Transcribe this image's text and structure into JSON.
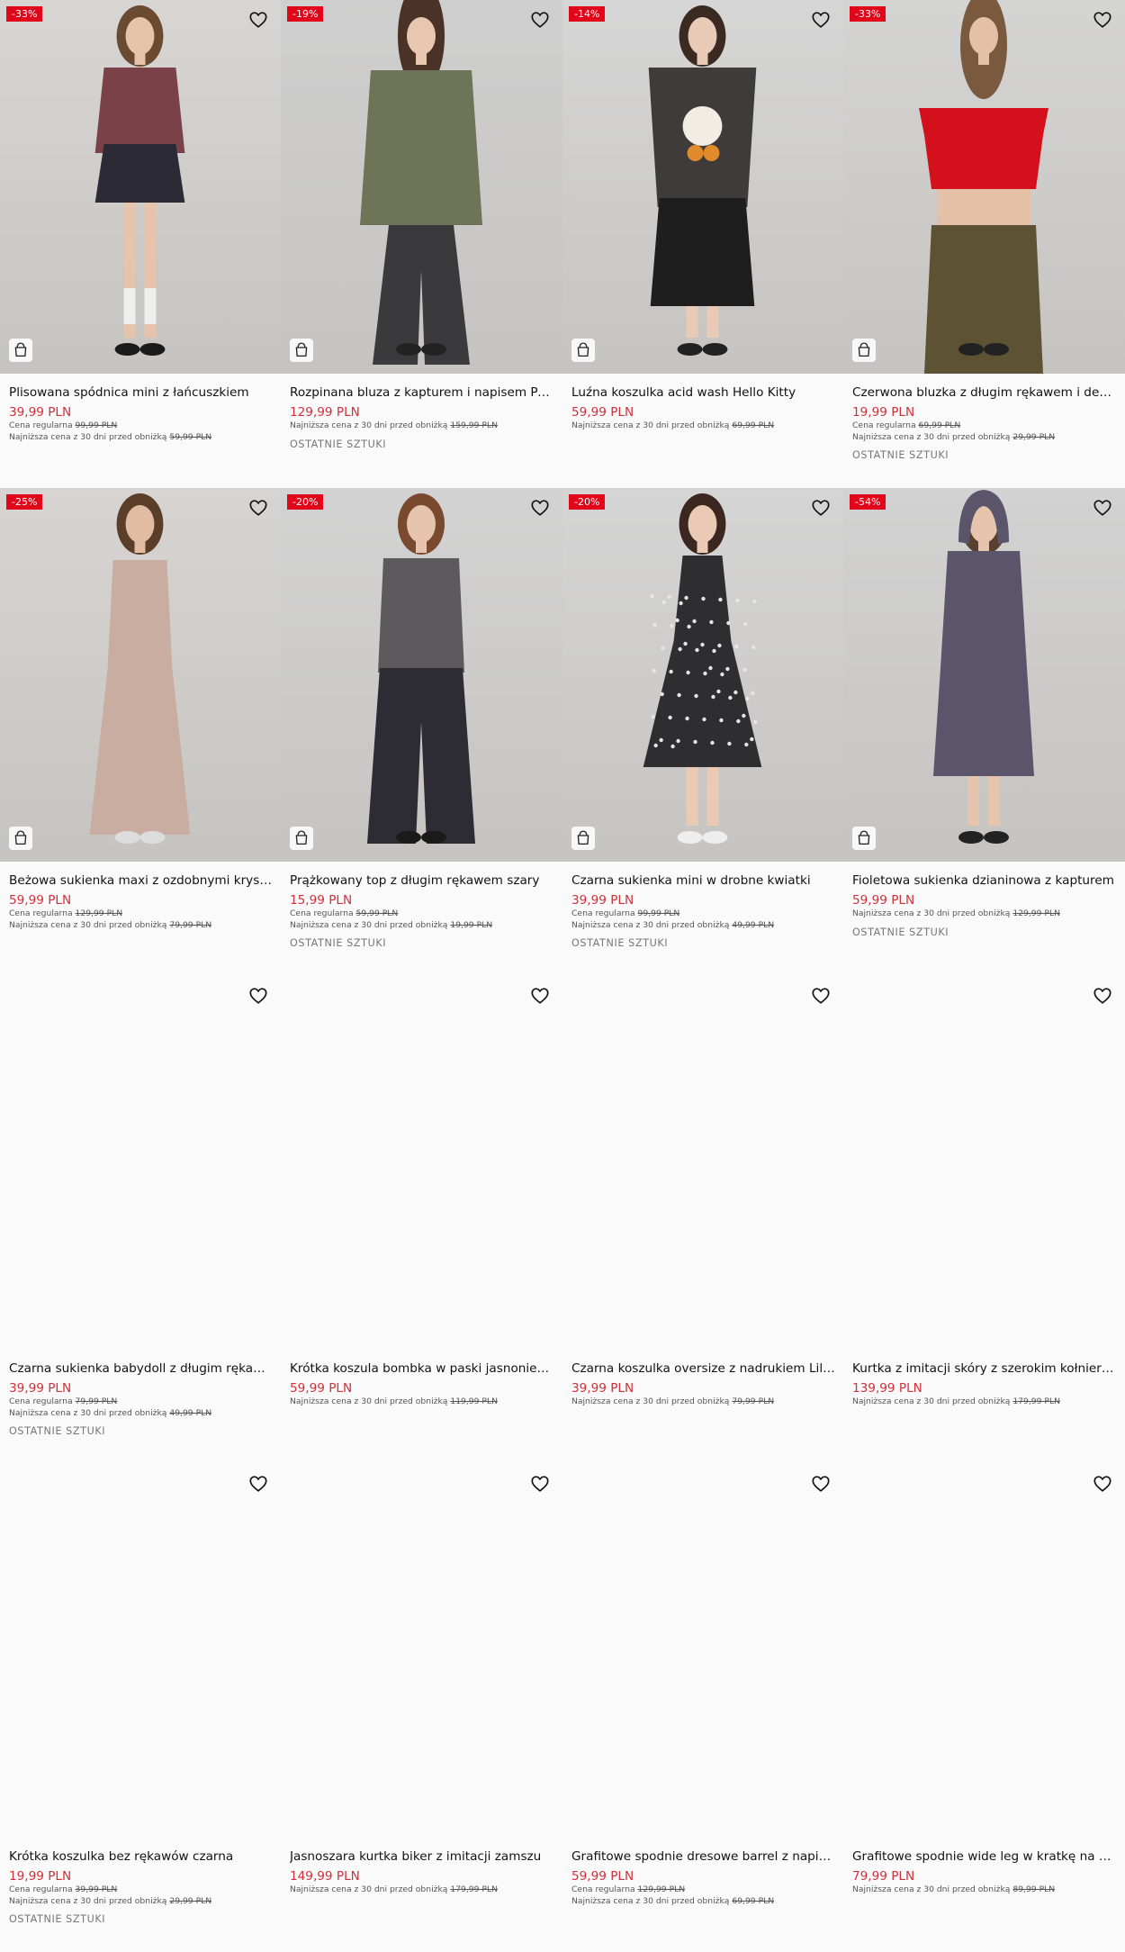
{
  "products": [
    {
      "name": "Plisowana spódnica mini z łańcuszkiem",
      "price": "39,99 PLN",
      "discount": "-33%",
      "regular_label": "Cena regularna",
      "regular_price": "99,99 PLN",
      "lowest_label": "Najniższa cena z 30 dni przed obniżką",
      "lowest_price": "59,99 PLN",
      "last_items": "",
      "image": "photo"
    },
    {
      "name": "Rozpinana bluza z kapturem i napisem Persona",
      "price": "129,99 PLN",
      "discount": "-19%",
      "regular_label": "",
      "regular_price": "",
      "lowest_label": "Najniższa cena z 30 dni przed obniżką",
      "lowest_price": "159,99 PLN",
      "last_items": "OSTATNIE SZTUKI",
      "image": "photo"
    },
    {
      "name": "Luźna koszulka acid wash Hello Kitty",
      "price": "59,99 PLN",
      "discount": "-14%",
      "regular_label": "",
      "regular_price": "",
      "lowest_label": "Najniższa cena z 30 dni przed obniżką",
      "lowest_price": "69,99 PLN",
      "last_items": "",
      "image": "photo"
    },
    {
      "name": "Czerwona bluzka z długim rękawem i dekoltem carmen",
      "price": "19,99 PLN",
      "discount": "-33%",
      "regular_label": "Cena regularna",
      "regular_price": "69,99 PLN",
      "lowest_label": "Najniższa cena z 30 dni przed obniżką",
      "lowest_price": "29,99 PLN",
      "last_items": "OSTATNIE SZTUKI",
      "image": "photo"
    },
    {
      "name": "Beżowa sukienka maxi z ozdobnymi kryształkami",
      "price": "59,99 PLN",
      "discount": "-25%",
      "regular_label": "Cena regularna",
      "regular_price": "129,99 PLN",
      "lowest_label": "Najniższa cena z 30 dni przed obniżką",
      "lowest_price": "79,99 PLN",
      "last_items": "",
      "image": "photo"
    },
    {
      "name": "Prążkowany top z długim rękawem szary",
      "price": "15,99 PLN",
      "discount": "-20%",
      "regular_label": "Cena regularna",
      "regular_price": "59,99 PLN",
      "lowest_label": "Najniższa cena z 30 dni przed obniżką",
      "lowest_price": "19,99 PLN",
      "last_items": "OSTATNIE SZTUKI",
      "image": "photo"
    },
    {
      "name": "Czarna sukienka mini w drobne kwiatki",
      "price": "39,99 PLN",
      "discount": "-20%",
      "regular_label": "Cena regularna",
      "regular_price": "99,99 PLN",
      "lowest_label": "Najniższa cena z 30 dni przed obniżką",
      "lowest_price": "49,99 PLN",
      "last_items": "OSTATNIE SZTUKI",
      "image": "photo"
    },
    {
      "name": "Fioletowa sukienka dzianinowa z kapturem",
      "price": "59,99 PLN",
      "discount": "-54%",
      "regular_label": "",
      "regular_price": "",
      "lowest_label": "Najniższa cena z 30 dni przed obniżką",
      "lowest_price": "129,99 PLN",
      "last_items": "OSTATNIE SZTUKI",
      "image": "photo"
    },
    {
      "name": "Czarna sukienka babydoll z długim rękawem",
      "price": "39,99 PLN",
      "discount": "",
      "regular_label": "Cena regularna",
      "regular_price": "79,99 PLN",
      "lowest_label": "Najniższa cena z 30 dni przed obniżką",
      "lowest_price": "49,99 PLN",
      "last_items": "OSTATNIE SZTUKI",
      "image": "blank"
    },
    {
      "name": "Krótka koszula bombka w paski jasnoniebieska",
      "price": "59,99 PLN",
      "discount": "",
      "regular_label": "",
      "regular_price": "",
      "lowest_label": "Najniższa cena z 30 dni przed obniżką",
      "lowest_price": "119,99 PLN",
      "last_items": "",
      "image": "blank"
    },
    {
      "name": "Czarna koszulka oversize z nadrukiem Lil Wayne",
      "price": "39,99 PLN",
      "discount": "",
      "regular_label": "",
      "regular_price": "",
      "lowest_label": "Najniższa cena z 30 dni przed obniżką",
      "lowest_price": "79,99 PLN",
      "last_items": "",
      "image": "blank"
    },
    {
      "name": "Kurtka z imitacji skóry z szerokim kołnierzem",
      "price": "139,99 PLN",
      "discount": "",
      "regular_label": "",
      "regular_price": "",
      "lowest_label": "Najniższa cena z 30 dni przed obniżką",
      "lowest_price": "179,99 PLN",
      "last_items": "",
      "image": "blank"
    },
    {
      "name": "Krótka koszulka bez rękawów czarna",
      "price": "19,99 PLN",
      "discount": "",
      "regular_label": "Cena regularna",
      "regular_price": "39,99 PLN",
      "lowest_label": "Najniższa cena z 30 dni przed obniżką",
      "lowest_price": "29,99 PLN",
      "last_items": "OSTATNIE SZTUKI",
      "image": "blank"
    },
    {
      "name": "Jasnoszara kurtka biker z imitacji zamszu",
      "price": "149,99 PLN",
      "discount": "",
      "regular_label": "",
      "regular_price": "",
      "lowest_label": "Najniższa cena z 30 dni przed obniżką",
      "lowest_price": "179,99 PLN",
      "last_items": "",
      "image": "blank"
    },
    {
      "name": "Grafitowe spodnie dresowe barrel z napisem",
      "price": "59,99 PLN",
      "discount": "",
      "regular_label": "Cena regularna",
      "regular_price": "129,99 PLN",
      "lowest_label": "Najniższa cena z 30 dni przed obniżką",
      "lowest_price": "69,99 PLN",
      "last_items": "",
      "image": "blank"
    },
    {
      "name": "Grafitowe spodnie wide leg w kratkę na gumce",
      "price": "79,99 PLN",
      "discount": "",
      "regular_label": "",
      "regular_price": "",
      "lowest_label": "Najniższa cena z 30 dni przed obniżką",
      "lowest_price": "89,99 PLN",
      "last_items": "",
      "image": "blank"
    }
  ],
  "colors": {
    "price": "#d0303a",
    "badge": "#e2061a",
    "text": "#111111",
    "muted": "#777777"
  },
  "icons": {
    "wishlist": "heart-icon",
    "add_to_cart": "shopping-bag-icon"
  }
}
